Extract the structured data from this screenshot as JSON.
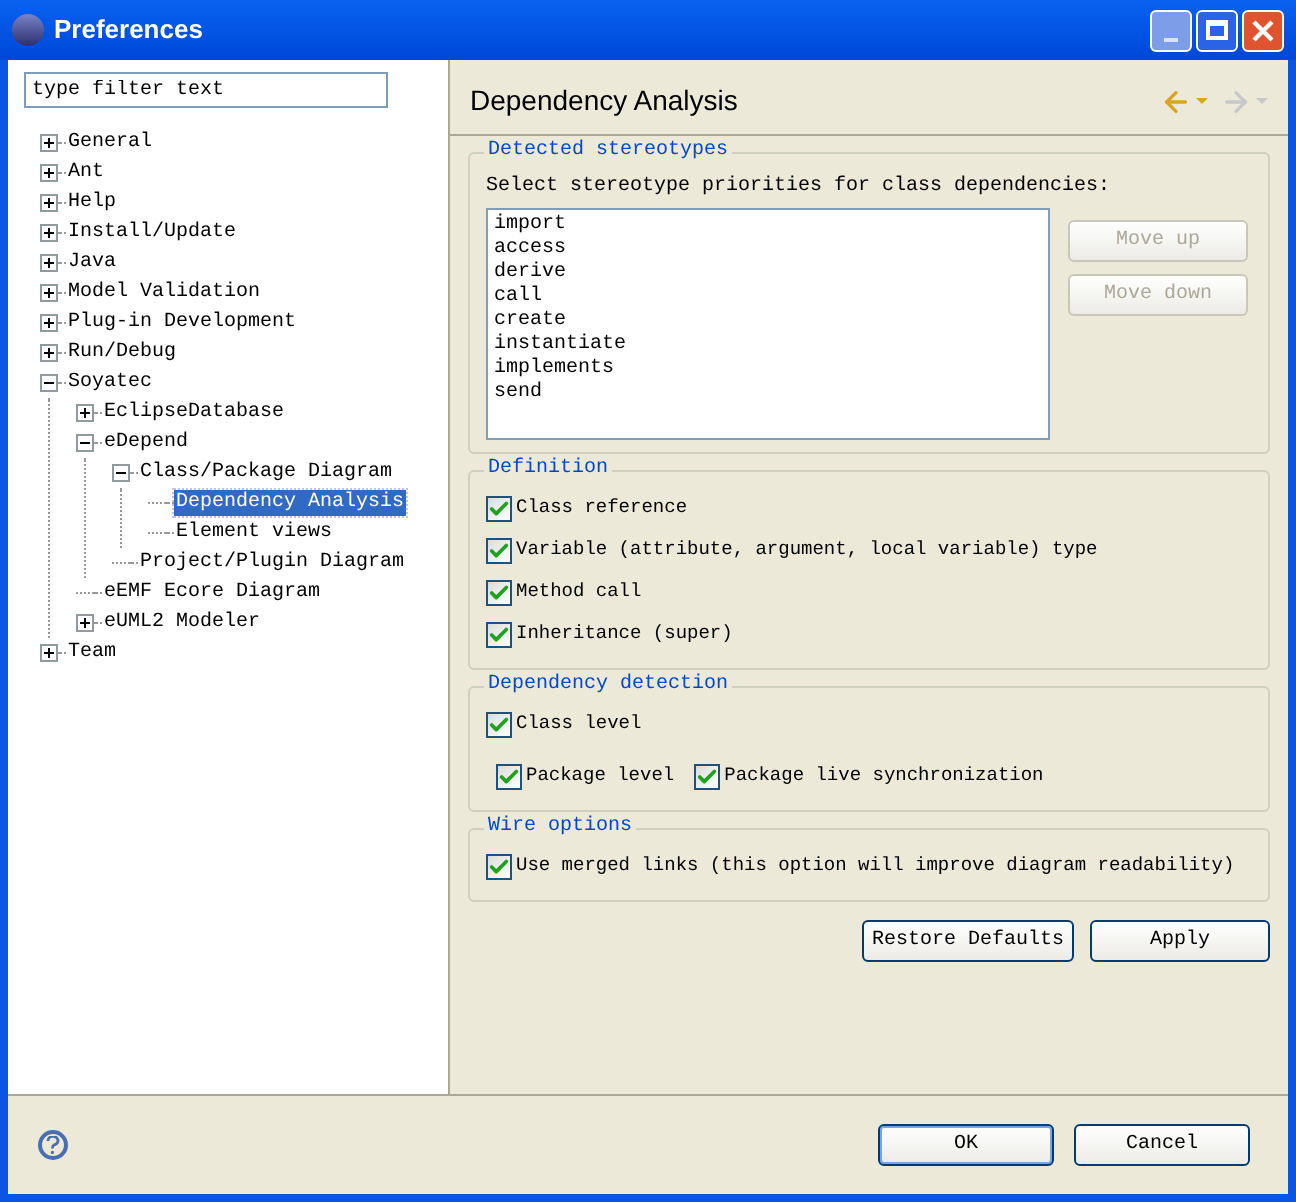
{
  "window": {
    "title": "Preferences"
  },
  "filter": {
    "value": "type filter text"
  },
  "tree": [
    {
      "label": "General",
      "expanded": false,
      "selected": false
    },
    {
      "label": "Ant",
      "expanded": false,
      "selected": false
    },
    {
      "label": "Help",
      "expanded": false,
      "selected": false
    },
    {
      "label": "Install/Update",
      "expanded": false,
      "selected": false
    },
    {
      "label": "Java",
      "expanded": false,
      "selected": false
    },
    {
      "label": "Model Validation",
      "expanded": false,
      "selected": false
    },
    {
      "label": "Plug-in Development",
      "expanded": false,
      "selected": false
    },
    {
      "label": "Run/Debug",
      "expanded": false,
      "selected": false
    },
    {
      "label": "Soyatec",
      "expanded": true,
      "selected": false,
      "children": [
        {
          "label": "EclipseDatabase",
          "expanded": false,
          "selected": false
        },
        {
          "label": "eDepend",
          "expanded": true,
          "selected": false,
          "children": [
            {
              "label": "Class/Package Diagram",
              "expanded": true,
              "selected": false,
              "children": [
                {
                  "label": "Dependency Analysis",
                  "selected": true
                },
                {
                  "label": "Element views",
                  "selected": false
                }
              ]
            },
            {
              "label": "Project/Plugin Diagram",
              "selected": false
            }
          ]
        },
        {
          "label": "eEMF Ecore Diagram",
          "selected": false
        },
        {
          "label": "eUML2 Modeler",
          "expanded": false,
          "selected": false
        }
      ]
    },
    {
      "label": "Team",
      "expanded": false,
      "selected": false
    }
  ],
  "page": {
    "title": "Dependency Analysis",
    "nav": [
      {
        "kind": "back",
        "disabled": false
      },
      {
        "kind": "forward",
        "disabled": true
      }
    ]
  },
  "stereotypes": {
    "title": "Detected stereotypes",
    "prompt": "Select stereotype priorities for class dependencies:",
    "items": [
      "import",
      "access",
      "derive",
      "call",
      "create",
      "instantiate",
      "implements",
      "send"
    ],
    "buttons": [
      {
        "label": "Move up",
        "disabled": true
      },
      {
        "label": "Move down",
        "disabled": true
      }
    ]
  },
  "groups": [
    {
      "title": "Definition",
      "options": [
        {
          "label": "Class reference",
          "checked": true,
          "kind": "row"
        },
        {
          "label": "Variable (attribute, argument, local variable) type",
          "checked": true,
          "kind": "row"
        },
        {
          "label": "Method call",
          "checked": true,
          "kind": "row"
        },
        {
          "label": "Inheritance (super)",
          "checked": true,
          "kind": "row"
        }
      ]
    },
    {
      "title": "Dependency detection",
      "options": [
        {
          "label": "Class level",
          "checked": true,
          "kind": "row"
        },
        {
          "label": "Package level",
          "checked": true,
          "kind": "inline"
        },
        {
          "label": "Package live synchronization",
          "checked": true,
          "kind": "inline"
        }
      ]
    },
    {
      "title": "Wire options",
      "options": [
        {
          "label": "Use merged links (this option will improve diagram readability)",
          "checked": true,
          "kind": "row"
        }
      ]
    }
  ],
  "actions": [
    "Restore Defaults",
    "Apply"
  ],
  "footer_buttons": [
    {
      "label": "OK",
      "default": true
    },
    {
      "label": "Cancel",
      "default": false
    }
  ]
}
